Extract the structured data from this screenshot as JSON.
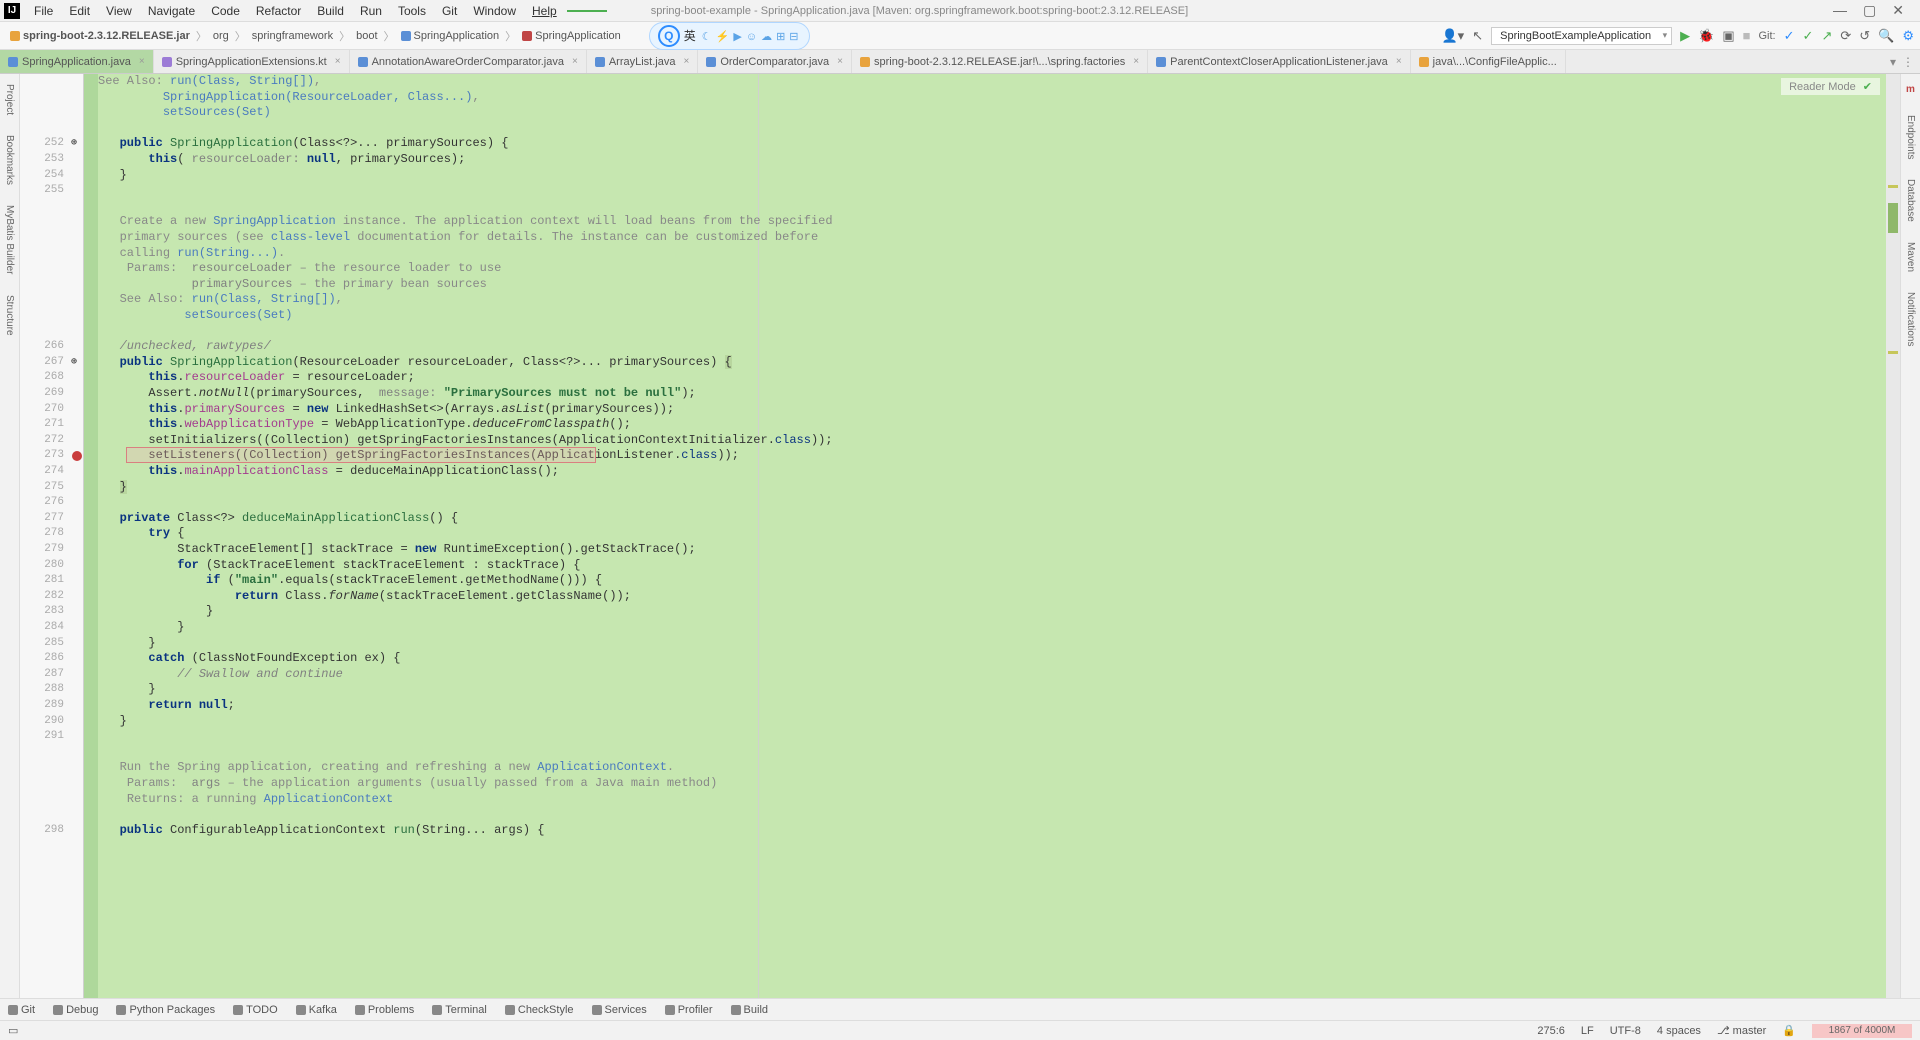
{
  "title": "spring-boot-example - SpringApplication.java [Maven: org.springframework.boot:spring-boot:2.3.12.RELEASE]",
  "menu": [
    "File",
    "Edit",
    "View",
    "Navigate",
    "Code",
    "Refactor",
    "Build",
    "Run",
    "Tools",
    "Git",
    "Window",
    "Help"
  ],
  "breadcrumb": [
    {
      "icon": "lib",
      "text": "spring-boot-2.3.12.RELEASE.jar"
    },
    {
      "text": "org"
    },
    {
      "text": "springframework"
    },
    {
      "text": "boot"
    },
    {
      "icon": "cls",
      "text": "SpringApplication"
    },
    {
      "icon": "mth",
      "text": "SpringApplication"
    }
  ],
  "ime": {
    "letter": "Q",
    "sub": "英",
    "icons": [
      "☾",
      "⚡",
      "▶",
      "☺",
      "☁",
      "⊞",
      "⊟"
    ]
  },
  "runConfig": "SpringBootExampleApplication",
  "gitLabel": "Git:",
  "readerMode": "Reader Mode",
  "tabs": [
    {
      "icon": "c",
      "label": "SpringApplication.java",
      "active": true,
      "close": true
    },
    {
      "icon": "k",
      "label": "SpringApplicationExtensions.kt",
      "close": true
    },
    {
      "icon": "c",
      "label": "AnnotationAwareOrderComparator.java",
      "close": true
    },
    {
      "icon": "c",
      "label": "ArrayList.java",
      "close": true
    },
    {
      "icon": "c",
      "label": "OrderComparator.java",
      "close": true
    },
    {
      "icon": "x",
      "label": "spring-boot-2.3.12.RELEASE.jar!\\...\\spring.factories",
      "close": true
    },
    {
      "icon": "c",
      "label": "ParentContextCloserApplicationListener.java",
      "close": true
    },
    {
      "icon": "x",
      "label": "java\\...\\ConfigFileApplic..."
    }
  ],
  "leftTools": [
    "Project",
    "Bookmarks",
    "MyBatis Builder",
    "Structure"
  ],
  "rightTools": [
    "Endpoints",
    "Database",
    "Maven",
    "Notifications"
  ],
  "rightToolTop": "m",
  "bottomTools": [
    "Git",
    "Debug",
    "Python Packages",
    "TODO",
    "Kafka",
    "Problems",
    "Terminal",
    "CheckStyle",
    "Services",
    "Profiler",
    "Build"
  ],
  "status": {
    "cursor": "275:6",
    "lf": "LF",
    "encoding": "UTF-8",
    "indent": "4 spaces",
    "branch": "master",
    "mem": "1867 of 4000M"
  },
  "lines": [
    {
      "n": "",
      "html": "<span class='doc-block'>See Also: </span><span class='link'>run(Class, String[])</span><span class='doc-block'>,</span>"
    },
    {
      "n": "",
      "html": "         <span class='link'>SpringApplication(ResourceLoader, Class...)</span><span class='doc-block'>,</span>"
    },
    {
      "n": "",
      "html": "         <span class='link'>setSources(Set)</span>"
    },
    {
      "n": "",
      "html": ""
    },
    {
      "n": "252",
      "mark": "⊕",
      "html": "   <span class='kw'>public</span> <span class='mname'>SpringApplication</span>(Class&lt;?&gt;... primarySources) {"
    },
    {
      "n": "253",
      "html": "       <span class='kw'>this</span>( <span class='param'>resourceLoader:</span> <span class='kw'>null</span>, primarySources);"
    },
    {
      "n": "254",
      "html": "   }"
    },
    {
      "n": "255",
      "html": ""
    },
    {
      "n": "",
      "html": ""
    },
    {
      "n": "",
      "html": "   <span class='doc-block'>Create a new </span><span class='link'>SpringApplication</span><span class='doc-block'> instance. The application context will load beans from the specified</span>"
    },
    {
      "n": "",
      "html": "   <span class='doc-block'>primary sources (see </span><span class='link'>class-level</span><span class='doc-block'> documentation for details. The instance can be customized before</span>"
    },
    {
      "n": "",
      "html": "   <span class='doc-block'>calling </span><span class='link'>run(String...)</span><span class='doc-block'>.</span>"
    },
    {
      "n": "",
      "html": "    <span class='doc-block'>Params:  </span><span class='param'>resourceLoader</span><span class='doc-block'> – the resource loader to use</span>"
    },
    {
      "n": "",
      "html": "             <span class='param'>primarySources</span><span class='doc-block'> – the primary bean sources</span>"
    },
    {
      "n": "",
      "html": "   <span class='doc-block'>See Also: </span><span class='link'>run(Class, String[])</span><span class='doc-block'>,</span>"
    },
    {
      "n": "",
      "html": "            <span class='link'>setSources(Set)</span>"
    },
    {
      "n": "",
      "html": ""
    },
    {
      "n": "266",
      "html": "   <span class='ann'>/unchecked, rawtypes/</span>"
    },
    {
      "n": "267",
      "mark": "⊕",
      "html": "   <span class='kw'>public</span> <span class='mname'>SpringApplication</span>(ResourceLoader resourceLoader, Class&lt;?&gt;... primarySources) <span style='background:#b8d69e'>{</span>"
    },
    {
      "n": "268",
      "html": "       <span class='kw'>this</span>.<span class='fld'>resourceLoader</span> = resourceLoader;"
    },
    {
      "n": "269",
      "html": "       Assert.<span class='static'>notNull</span>(primarySources,  <span class='param'>message:</span> <span class='str'>\"PrimarySources must not be null\"</span>);"
    },
    {
      "n": "270",
      "html": "       <span class='kw'>this</span>.<span class='fld'>primarySources</span> = <span class='kw'>new</span> LinkedHashSet&lt;&gt;(Arrays.<span class='static'>asList</span>(primarySources));"
    },
    {
      "n": "271",
      "html": "       <span class='kw'>this</span>.<span class='fld'>webApplicationType</span> = WebApplicationType.<span class='static'>deduceFromClasspath</span>();"
    },
    {
      "n": "272",
      "html": "       setInitializers((Collection) getSpringFactoriesInstances(ApplicationContextInitializer.<span class='kw2'>class</span>));"
    },
    {
      "n": "273",
      "bp": true,
      "html": "       setListeners((Collection) getSpringFactoriesInstances(ApplicationListener.<span class='kw2'>class</span>));"
    },
    {
      "n": "274",
      "html": "       <span class='kw'>this</span>.<span class='fld'>mainApplicationClass</span> = deduceMainApplicationClass();"
    },
    {
      "n": "275",
      "caret": true,
      "html": "   <span style='background:#b8d69e'>}</span>"
    },
    {
      "n": "276",
      "html": ""
    },
    {
      "n": "277",
      "html": "   <span class='kw'>private</span> Class&lt;?&gt; <span class='mname'>deduceMainApplicationClass</span>() {"
    },
    {
      "n": "278",
      "html": "       <span class='kw'>try</span> {"
    },
    {
      "n": "279",
      "html": "           StackTraceElement[] stackTrace = <span class='kw'>new</span> RuntimeException().getStackTrace();"
    },
    {
      "n": "280",
      "html": "           <span class='kw'>for</span> (StackTraceElement stackTraceElement : stackTrace) {"
    },
    {
      "n": "281",
      "html": "               <span class='kw'>if</span> (<span class='str'>\"main\"</span>.equals(stackTraceElement.getMethodName())) {"
    },
    {
      "n": "282",
      "html": "                   <span class='kw'>return</span> Class.<span class='static'>forName</span>(stackTraceElement.getClassName());"
    },
    {
      "n": "283",
      "html": "               }"
    },
    {
      "n": "284",
      "html": "           }"
    },
    {
      "n": "285",
      "html": "       }"
    },
    {
      "n": "286",
      "html": "       <span class='kw'>catch</span> (ClassNotFoundException ex) {"
    },
    {
      "n": "287",
      "html": "           <span class='ann'>// Swallow and continue</span>"
    },
    {
      "n": "288",
      "html": "       }"
    },
    {
      "n": "289",
      "html": "       <span class='kw'>return</span> <span class='kw'>null</span>;"
    },
    {
      "n": "290",
      "html": "   }"
    },
    {
      "n": "291",
      "html": ""
    },
    {
      "n": "",
      "html": ""
    },
    {
      "n": "",
      "html": "   <span class='doc-block'>Run the Spring application, creating and refreshing a new </span><span class='link'>ApplicationContext</span><span class='doc-block'>.</span>"
    },
    {
      "n": "",
      "html": "    <span class='doc-block'>Params:  </span><span class='param'>args</span><span class='doc-block'> – the application arguments (usually passed from a Java main method)</span>"
    },
    {
      "n": "",
      "html": "    <span class='doc-block'>Returns: a running </span><span class='link'>ApplicationContext</span>"
    },
    {
      "n": "",
      "html": ""
    },
    {
      "n": "298",
      "html": "   <span class='kw'>public</span> ConfigurableApplicationContext <span class='mname'>run</span>(String... args) {"
    }
  ]
}
